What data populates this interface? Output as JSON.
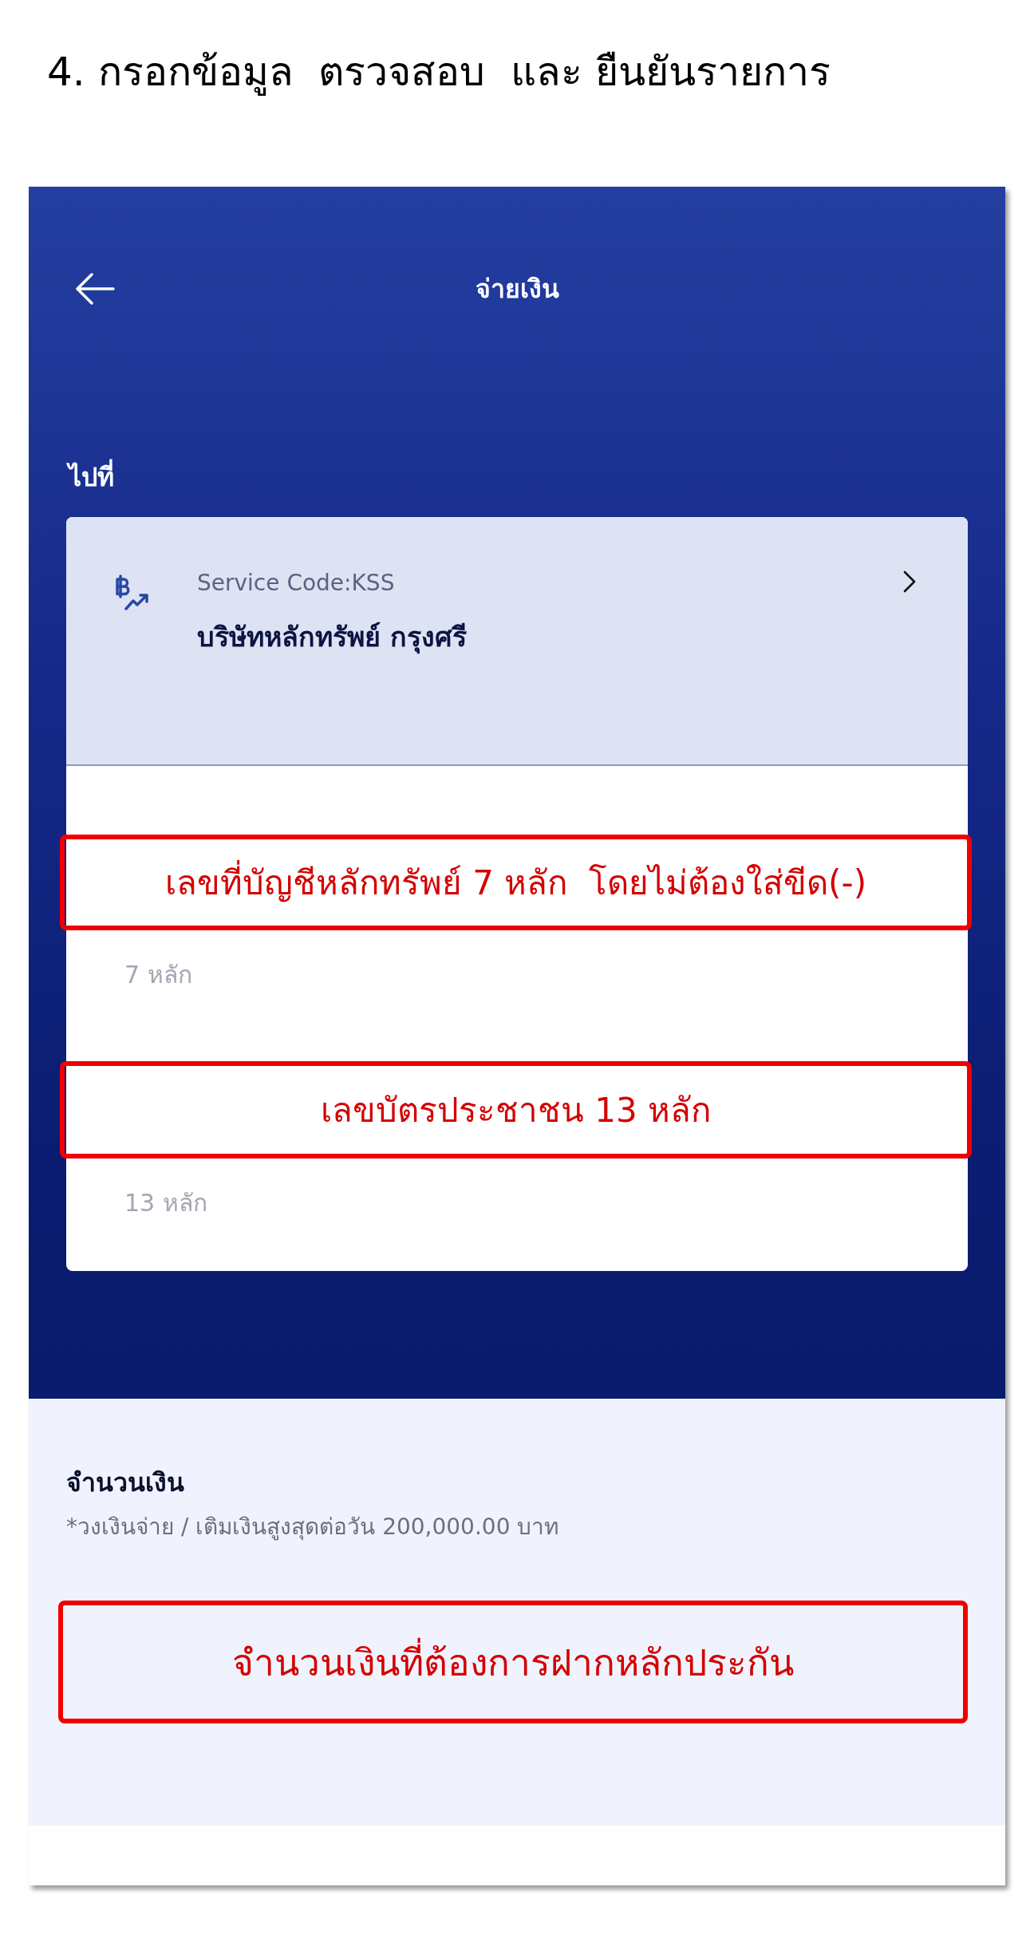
{
  "heading": "4. กรอกข้อมูล  ตรวจสอบ  และ ยืนยันรายการ",
  "app_bar": {
    "title": "จ่ายเงิน"
  },
  "destination": {
    "label": "ไปที่",
    "service_code": "Service Code:KSS",
    "name": "บริษัทหลักทรัพย์ กรุงศรี"
  },
  "fields": [
    {
      "callout": "เลขที่บัญชีหลักทรัพย์ 7 หลัก  โดยไม่ต้องใส่ขีด(-)",
      "placeholder": "7 หลัก"
    },
    {
      "callout": "เลขบัตรประชาชน 13 หลัก",
      "placeholder": "13 หลัก"
    }
  ],
  "amount": {
    "label": "จำนวนเงิน",
    "note": "*วงเงินจ่าย / เติมเงินสูงสุดต่อวัน 200,000.00 บาท",
    "callout": "จำนวนเงินที่ต้องการฝากหลักประกัน"
  }
}
